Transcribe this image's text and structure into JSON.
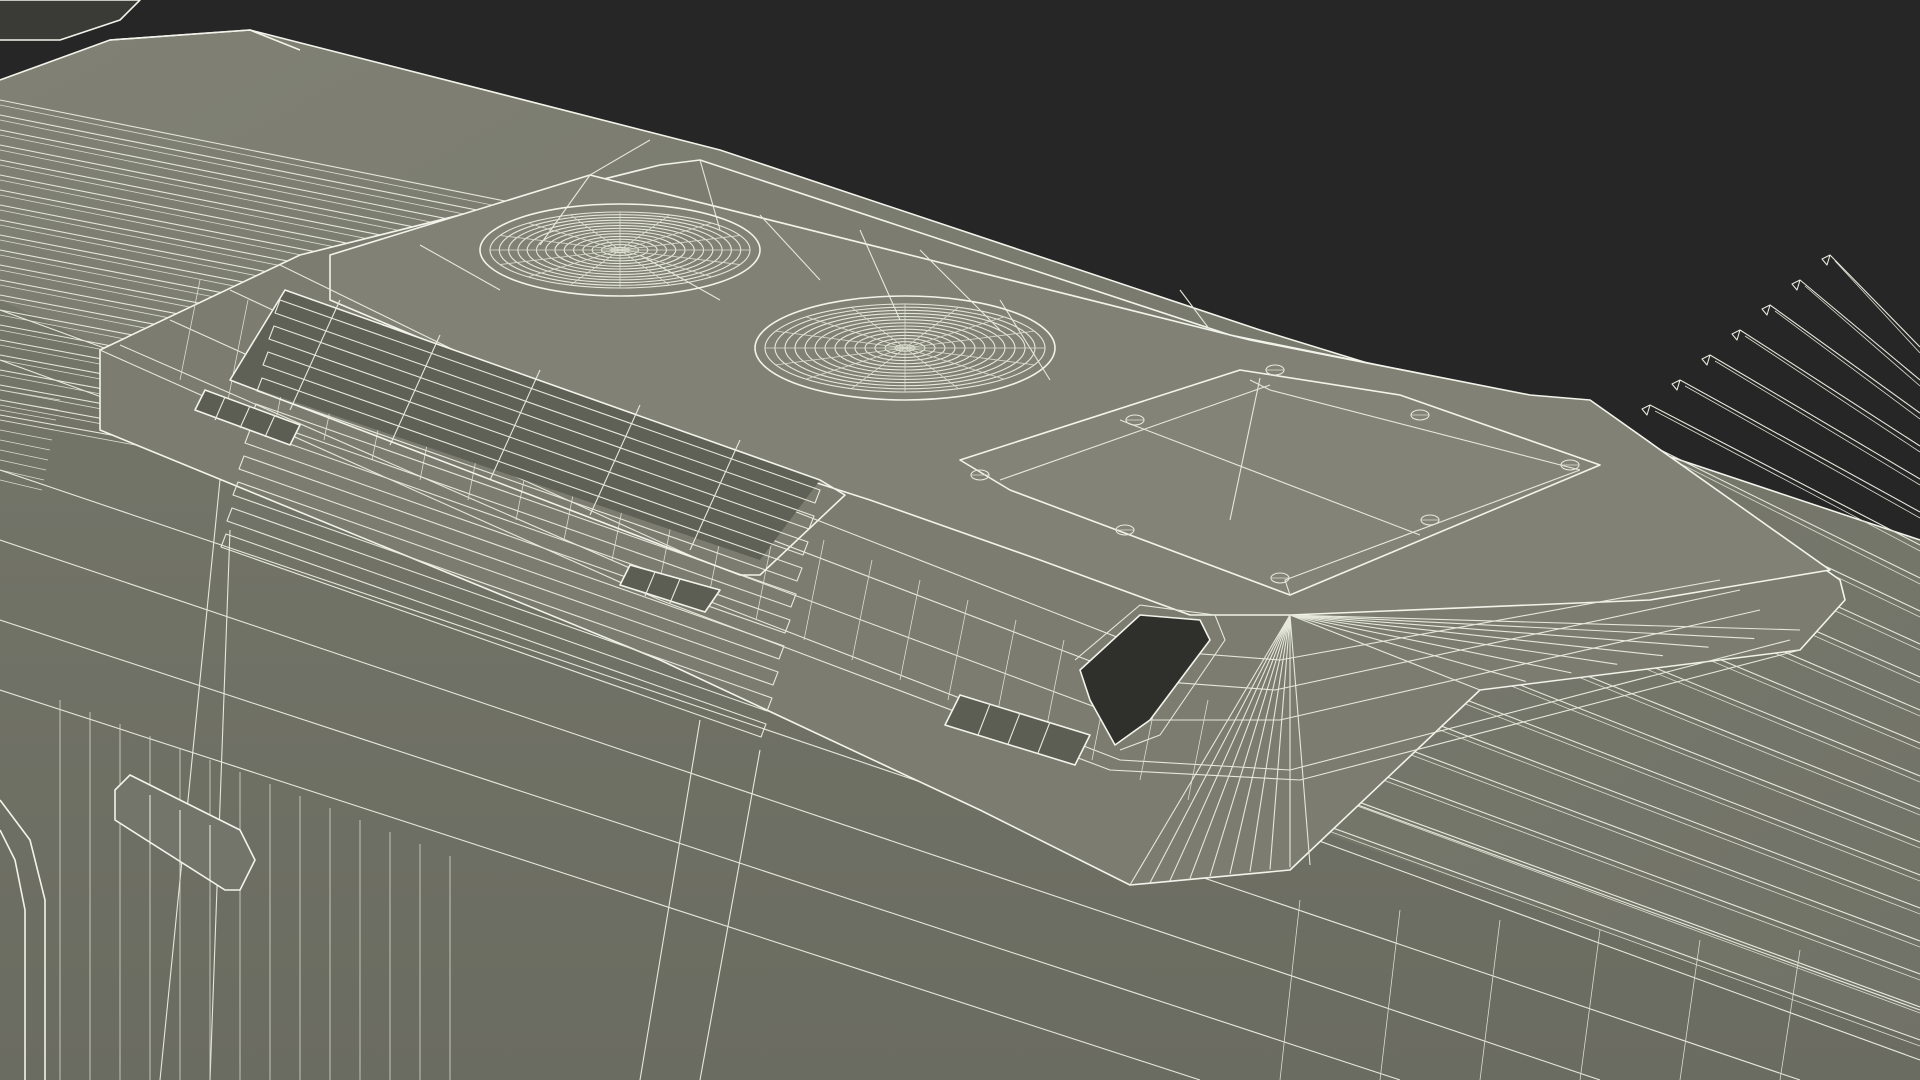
{
  "scene": {
    "background_color": "#262626",
    "surface_color": "#7b7c6f",
    "surface_shadow_color": "#6a6b60",
    "wire_color": "#e6e8dc",
    "panel_color": "#838477"
  }
}
